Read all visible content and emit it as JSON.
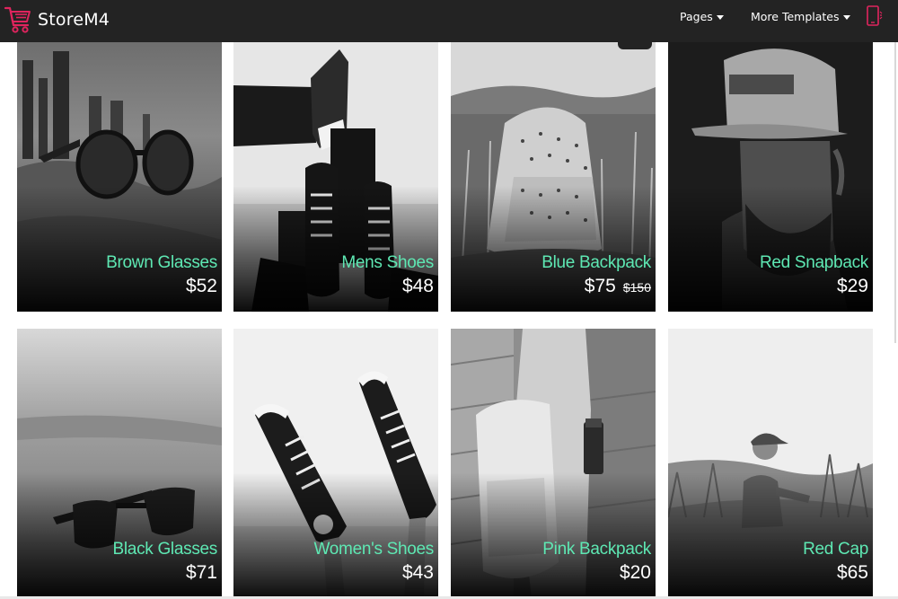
{
  "brand": {
    "name": "StoreM4",
    "accent": "#e0245e"
  },
  "nav": {
    "pages_label": "Pages",
    "more_templates_label": "More Templates",
    "mobile_icon": "mobile-phone-icon"
  },
  "colors": {
    "navbar_bg": "#232323",
    "product_name": "#5ee8b3",
    "price": "#ffffff"
  },
  "products": [
    {
      "name": "Brown Glasses",
      "price": "$52",
      "old_price": ""
    },
    {
      "name": "Mens Shoes",
      "price": "$48",
      "old_price": ""
    },
    {
      "name": "Blue Backpack",
      "price": "$75",
      "old_price": "$150"
    },
    {
      "name": "Red Snapback",
      "price": "$29",
      "old_price": ""
    },
    {
      "name": "Black Glasses",
      "price": "$71",
      "old_price": ""
    },
    {
      "name": "Women's Shoes",
      "price": "$43",
      "old_price": ""
    },
    {
      "name": "Pink Backpack",
      "price": "$20",
      "old_price": ""
    },
    {
      "name": "Red Cap",
      "price": "$65",
      "old_price": ""
    }
  ]
}
